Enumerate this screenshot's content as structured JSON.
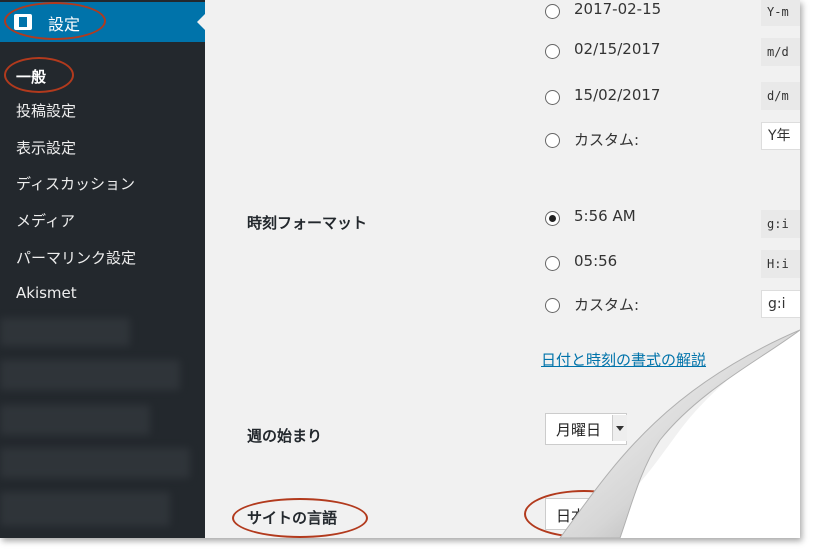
{
  "sidebar": {
    "menu_title": "設定",
    "items": [
      {
        "label": "一般"
      },
      {
        "label": "投稿設定"
      },
      {
        "label": "表示設定"
      },
      {
        "label": "ディスカッション"
      },
      {
        "label": "メディア"
      },
      {
        "label": "パーマリンク設定"
      },
      {
        "label": "Akismet"
      }
    ]
  },
  "date_format": {
    "options": [
      {
        "label": "2017-02-15",
        "code": "Y-m"
      },
      {
        "label": "02/15/2017",
        "code": "m/d"
      },
      {
        "label": "15/02/2017",
        "code": "d/m"
      },
      {
        "label": "カスタム:",
        "custom_value": "Y年"
      }
    ]
  },
  "time_format": {
    "label": "時刻フォーマット",
    "options": [
      {
        "label": "5:56 AM",
        "code": "g:i",
        "checked": true
      },
      {
        "label": "05:56",
        "code": "H:i"
      },
      {
        "label": "カスタム:",
        "custom_value": "g:i"
      }
    ],
    "help_link": "日付と時刻の書式の解説"
  },
  "week_start": {
    "label": "週の始まり",
    "value": "月曜日"
  },
  "site_language": {
    "label": "サイトの言語",
    "value": "日本語"
  },
  "colors": {
    "sidebar_bg": "#23282d",
    "accent": "#0073aa",
    "annotation": "#b23a1d"
  },
  "icons": [
    "settings-icon",
    "radio-icon",
    "dropdown-caret-icon"
  ]
}
